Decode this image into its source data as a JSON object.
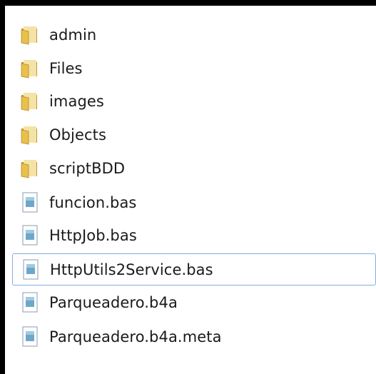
{
  "explorer": {
    "items": [
      {
        "name": "admin",
        "type": "folder",
        "icon": "folder-icon",
        "selected": false
      },
      {
        "name": "Files",
        "type": "folder",
        "icon": "folder-icon",
        "selected": false
      },
      {
        "name": "images",
        "type": "folder",
        "icon": "folder-icon",
        "selected": false
      },
      {
        "name": "Objects",
        "type": "folder",
        "icon": "folder-icon",
        "selected": false
      },
      {
        "name": "scriptBDD",
        "type": "folder",
        "icon": "folder-icon",
        "selected": false
      },
      {
        "name": "funcion.bas",
        "type": "file",
        "icon": "file-icon",
        "selected": false
      },
      {
        "name": "HttpJob.bas",
        "type": "file",
        "icon": "file-icon",
        "selected": false
      },
      {
        "name": "HttpUtils2Service.bas",
        "type": "file",
        "icon": "file-icon",
        "selected": true
      },
      {
        "name": "Parqueadero.b4a",
        "type": "file",
        "icon": "file-icon",
        "selected": false
      },
      {
        "name": "Parqueadero.b4a.meta",
        "type": "file",
        "icon": "file-icon",
        "selected": false
      }
    ]
  },
  "colors": {
    "folder": "#e8c14a",
    "folder_dark": "#c9962a",
    "selection_border": "#84acdd",
    "text": "#1a1a1a"
  }
}
